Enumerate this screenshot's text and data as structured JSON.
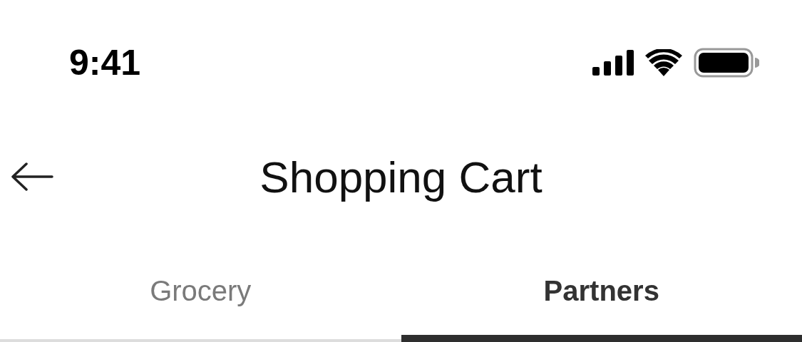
{
  "status_bar": {
    "time": "9:41"
  },
  "header": {
    "title": "Shopping Cart"
  },
  "tabs": [
    {
      "label": "Grocery",
      "selected": false
    },
    {
      "label": "Partners",
      "selected": true
    }
  ]
}
